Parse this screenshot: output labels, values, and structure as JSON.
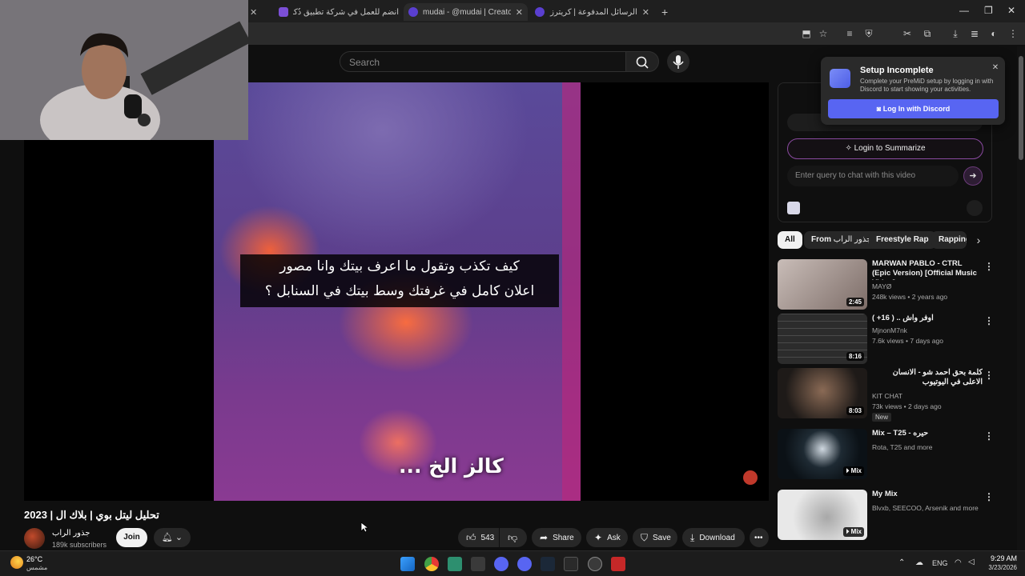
{
  "browser": {
    "tabs": [
      {
        "title": "...",
        "favicon_color": "#777777"
      },
      {
        "title": "انضم للعمل في شركة تطبيق ذُكار",
        "favicon_color": "#7b4fd6"
      },
      {
        "title": "mudai - @mudai | Creators",
        "favicon_color": "#5a3fd0"
      },
      {
        "title": "الرسائل المدفوعة | كريترز",
        "favicon_color": "#5a3fd0"
      }
    ],
    "new_tab_icon": "plus-icon"
  },
  "youtube": {
    "search_placeholder": "Search",
    "video": {
      "caption_line1": "كيف تكذب وتقول ما اعرف بيتك وانا مصور",
      "caption_line2": "اعلان كامل في غرفتك وسط بيتك في السنابل ؟",
      "caption_bottom": "كالز الخ ...",
      "title": "تحليل ليتل بوي | بلاك ال | 2023"
    },
    "channel": {
      "name": "جذور الراب",
      "subscribers": "189k subscribers",
      "join_label": "Join"
    },
    "actions": {
      "likes": "543",
      "share": "Share",
      "ask": "Ask",
      "save": "Save",
      "download": "Download"
    }
  },
  "premid_popup": {
    "title": "Setup Incomplete",
    "description": "Complete your PreMiD setup by logging in with Discord to start showing your activities.",
    "button": "Log In with Discord",
    "accent": "#5865f2"
  },
  "extension": {
    "summarize_label": "Login to Summarize",
    "chat_placeholder": "Enter query to chat with this video"
  },
  "chips": {
    "all": "All",
    "from_prefix": "From",
    "from_channel": "جذور الراب",
    "freestyle": "Freestyle Rap",
    "rapping": "Rapping"
  },
  "recommendations": [
    {
      "title": "MARWAN PABLO - CTRL (Epic Version) [Official Music Video]...",
      "channel": "MAYØ",
      "meta": "248k views • 2 years ago",
      "duration": "2:45",
      "thumb": "#9a8a84",
      "is_new": false
    },
    {
      "title": "اوفر واش .. ( 16+ )",
      "channel": "MjnonM7nk",
      "meta": "7.6k views • 7 days ago",
      "duration": "8:16",
      "thumb": "#3a3a3a",
      "is_new": false
    },
    {
      "title": "كلمة بحق احمد شو - الانسان الاعلى في اليوتيوب",
      "channel": "KIT CHAT",
      "meta": "73k views • 2 days ago",
      "duration": "8:03",
      "thumb": "#3c2a22",
      "is_new": true,
      "new_label": "New"
    },
    {
      "title": "Mix – T25 - حيره",
      "channel": "Rota, T25 and more",
      "meta": "",
      "duration": "Mix",
      "thumb": "#142028",
      "is_new": false
    },
    {
      "title": "My Mix",
      "channel": "Blvxb, SEECOO, Arsenik and more",
      "meta": "",
      "duration": "Mix",
      "thumb": "#dcdcdc",
      "is_new": false
    }
  ],
  "taskbar": {
    "temperature": "26°C",
    "weather": "مشمس",
    "language": "ENG",
    "time": "9:29 AM",
    "date": "3/23/2026"
  }
}
